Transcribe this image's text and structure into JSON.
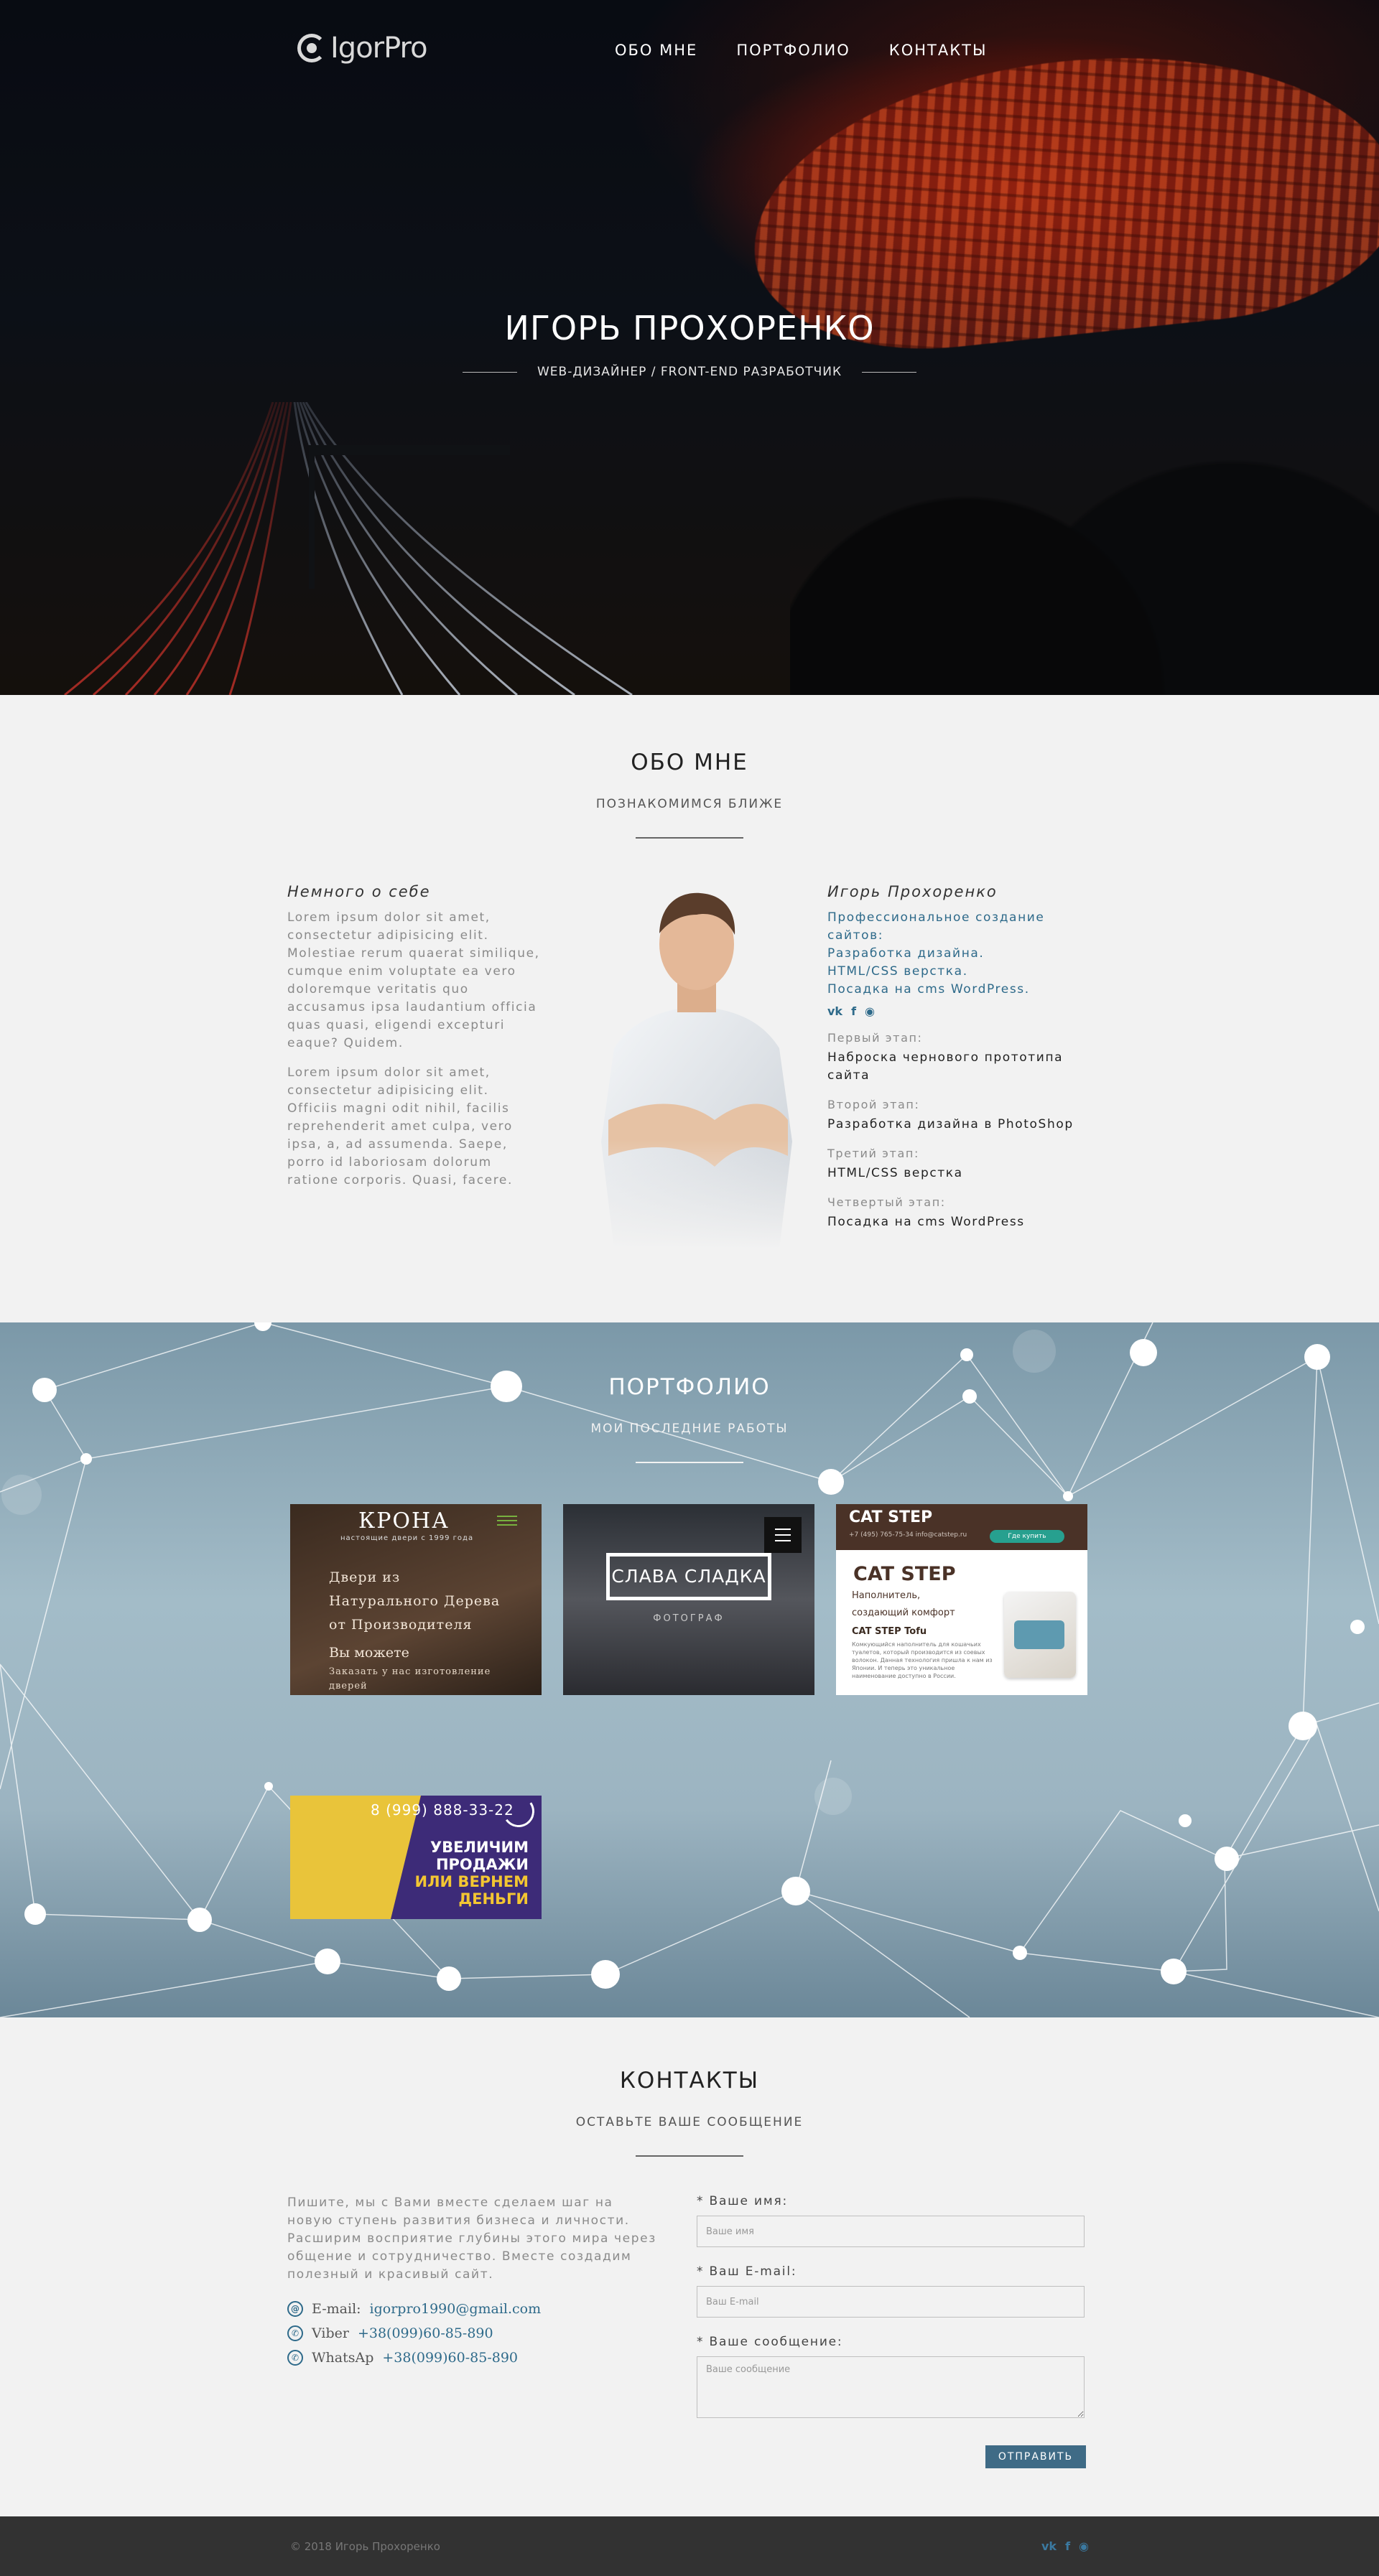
{
  "header": {
    "logo": "IgorPro",
    "menu": [
      "ОБО МНЕ",
      "ПОРТФОЛИО",
      "КОНТАКТЫ"
    ]
  },
  "hero": {
    "title": "ИГОРЬ ПРОХОРЕНКО",
    "subtitle": "WEB-ДИЗАЙНЕР / FRONT-END РАЗРАБОТЧИК"
  },
  "about": {
    "title": "ОБО МНЕ",
    "subtitle": "ПОЗНАКОМИМСЯ БЛИЖЕ",
    "left_heading": "Немного о себе",
    "left_p1": "Lorem ipsum dolor sit amet, consectetur adipisicing elit. Molestiae rerum quaerat similique, cumque enim voluptate ea vero doloremque veritatis quo accusamus ipsa laudantium officia quas quasi, eligendi excepturi eaque? Quidem.",
    "left_p2": "Lorem ipsum dolor sit amet, consectetur adipisicing elit. Officiis magni odit nihil, facilis reprehenderit amet culpa, vero ipsa, a, ad assumenda. Saepe, porro id laboriosam dolorum ratione corporis. Quasi, facere.",
    "right_heading": "Игорь Прохоренко",
    "links": [
      "Профессиональное создание сайтов:",
      "Разработка дизайна.",
      "HTML/CSS верстка.",
      "Посадка на cms WordPress."
    ],
    "social": [
      "vk-icon",
      "facebook-icon",
      "github-icon"
    ],
    "steps": [
      {
        "label": "Первый этап:",
        "value": "Наброска чернового прототипа сайта"
      },
      {
        "label": "Второй этап:",
        "value": "Разработка дизайна в PhotoShop"
      },
      {
        "label": "Третий этап:",
        "value": "HTML/CSS верстка"
      },
      {
        "label": "Четвертый этап:",
        "value": "Посадка на cms WordPress"
      }
    ]
  },
  "portfolio": {
    "title": "ПОРТФОЛИО",
    "subtitle": "МОИ ПОСЛЕДНИЕ РАБОТЫ",
    "card1": {
      "brand": "КРОНА",
      "brand_sub": "настоящие двери с 1999 года",
      "title": "Двери из\nНатурального Дерева\nот Производителя",
      "line1": "Вы можете",
      "line2": "Заказать у нас изготовление дверей"
    },
    "card2": {
      "title": "СЛАВА СЛАДКА",
      "subtitle": "ФОТОГРАФ"
    },
    "card3": {
      "logo": "CAT STEP",
      "top_info": "+7 (495) 765-75-34   info@catstep.ru",
      "button": "Где купить",
      "big": "CAT STEP",
      "sub": "Наполнитель, создающий комфорт",
      "product": "CAT STEP Tofu",
      "text": "Комкующийся наполнитель для кошачьих туалетов, который производится из соевых волокон. Данная технология пришла к нам из Японии. И теперь это уникальное наименование доступно в России."
    },
    "card4": {
      "phone": "8 (999) 888-33-22",
      "promo1": "УВЕЛИЧИМ",
      "promo2": "ПРОДАЖИ",
      "promo3": "ИЛИ ВЕРНЕМ",
      "promo4": "ДЕНЬГИ"
    }
  },
  "contacts": {
    "title": "КОНТАКТЫ",
    "subtitle": "ОСТАВЬТЕ ВАШЕ СООБЩЕНИЕ",
    "intro": "Пишите, мы с Вами вместе сделаем шаг на новую ступень развития бизнеса и личности. Расширим восприятие глубины этого мира через общение и сотрудничество. Вместе создадим полезный и красивый сайт.",
    "items": [
      {
        "icon": "at-icon",
        "label": "E-mail:",
        "value": "igorpro1990@gmail.com"
      },
      {
        "icon": "viber-icon",
        "label": "Viber",
        "value": "+38(099)60-85-890"
      },
      {
        "icon": "whatsapp-icon",
        "label": "WhatsAp",
        "value": "+38(099)60-85-890"
      }
    ],
    "form": {
      "name_label": "* Ваше имя:",
      "name_placeholder": "Ваше имя",
      "email_label": "* Ваш E-mail:",
      "email_placeholder": "Ваш E-mail",
      "message_label": "* Ваше сообщение:",
      "message_placeholder": "Ваше сообщение",
      "submit": "ОТПРАВИТЬ"
    }
  },
  "footer": {
    "copyright": "© 2018 Игорь Прохоренко",
    "social": [
      "vk-icon",
      "facebook-icon",
      "github-icon"
    ]
  },
  "colors": {
    "accent": "#2e6a8a",
    "button": "#3f6b86",
    "footer": "#323232"
  }
}
